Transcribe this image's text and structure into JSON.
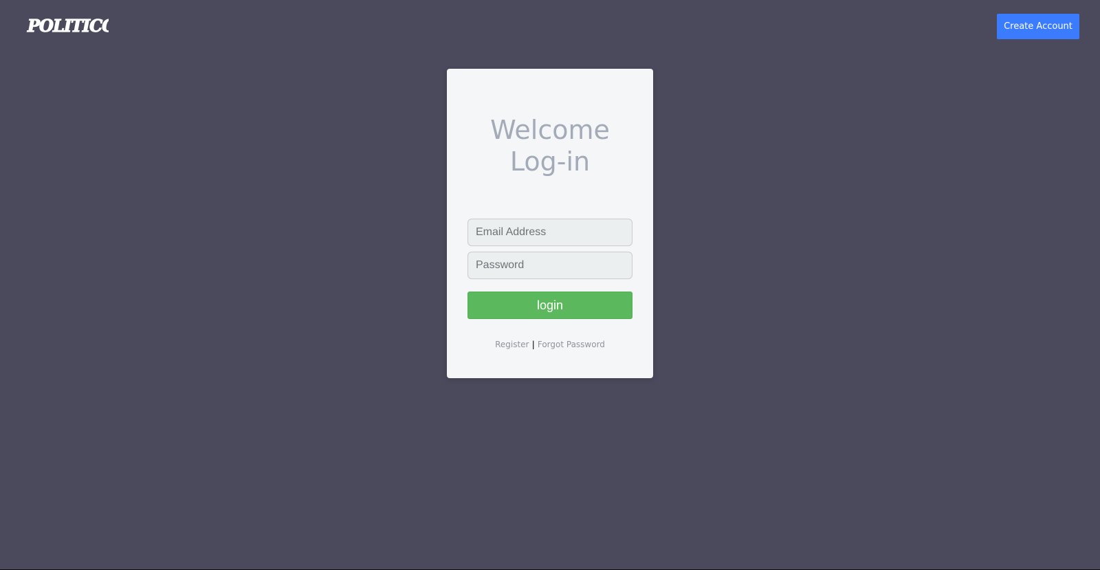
{
  "header": {
    "logo_text": "POLITICO",
    "create_account_label": "Create Account"
  },
  "login_card": {
    "title_line1": "Welcome",
    "title_line2": "Log-in",
    "email_placeholder": "Email Address",
    "password_placeholder": "Password",
    "login_label": "login",
    "register_label": "Register",
    "separator": "|",
    "forgot_password_label": "Forgot Password"
  },
  "colors": {
    "background": "#4a4a5c",
    "card": "#f5f6f8",
    "primary_button": "#3b7cff",
    "login_button": "#5cb85c",
    "title_text": "#a3aab8"
  }
}
